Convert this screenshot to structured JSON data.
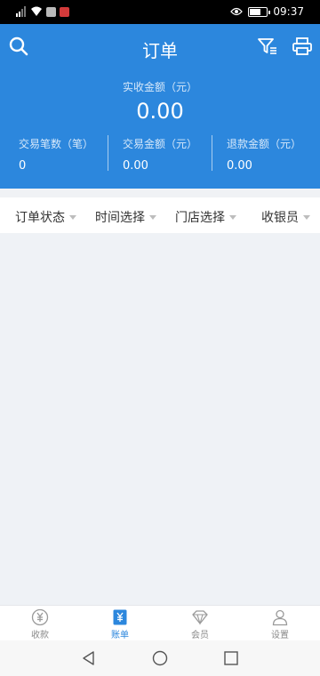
{
  "status_bar": {
    "time": "09:37",
    "battery_level": 0.6,
    "icons": [
      "signal-icon",
      "wifi-icon",
      "notification-icon",
      "notification-icon",
      "eye-icon",
      "battery-icon"
    ],
    "accent_red": "#d33a3a"
  },
  "header": {
    "title": "订单",
    "background": "#2c87dd",
    "icons": [
      "search-icon",
      "filter-icon",
      "printer-icon"
    ]
  },
  "summary": {
    "label": "实收金额（元）",
    "value": "0.00"
  },
  "stats": [
    {
      "label": "交易笔数（笔）",
      "value": "0"
    },
    {
      "label": "交易金额（元）",
      "value": "0.00"
    },
    {
      "label": "退款金额（元）",
      "value": "0.00"
    }
  ],
  "filters": [
    {
      "label": "订单状态"
    },
    {
      "label": "时间选择"
    },
    {
      "label": "门店选择"
    },
    {
      "label": "收银员"
    }
  ],
  "tabs": [
    {
      "label": "收款",
      "icon": "yuan-coin-icon",
      "active": false
    },
    {
      "label": "账单",
      "icon": "bill-icon",
      "active": true
    },
    {
      "label": "会员",
      "icon": "diamond-icon",
      "active": false
    },
    {
      "label": "设置",
      "icon": "user-icon",
      "active": false
    }
  ],
  "nav": [
    "back-icon",
    "home-icon",
    "recents-icon"
  ]
}
